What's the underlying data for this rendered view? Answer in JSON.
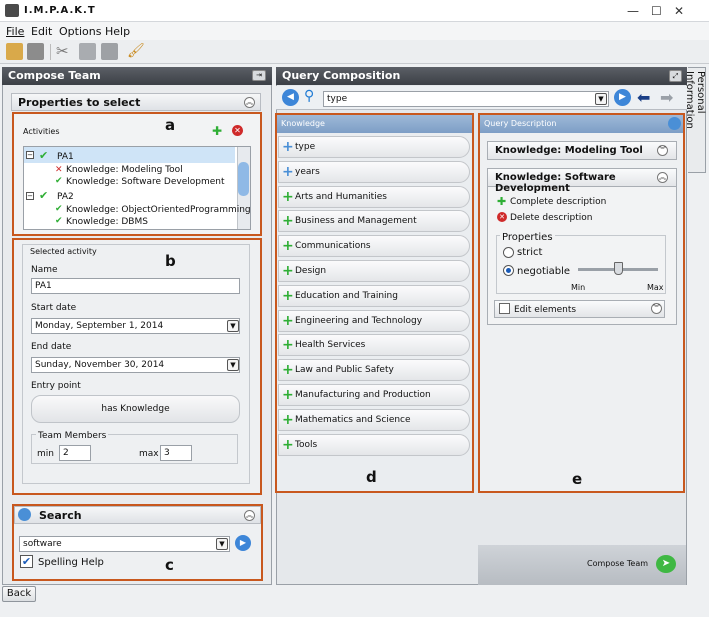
{
  "app": {
    "title": "I.M.P.A.K.T"
  },
  "window": {
    "minimize": "—",
    "maximize": "☐",
    "close": "✕"
  },
  "menu": [
    "File",
    "Edit",
    "Options",
    "Help"
  ],
  "left": {
    "panel_title": "Compose Team",
    "properties_title": "Properties to select",
    "activities_label": "Activities",
    "tree": [
      {
        "label": "PA1",
        "selected": true,
        "children": [
          "Knowledge: Modeling Tool",
          "Knowledge: Software Development"
        ]
      },
      {
        "label": "PA2",
        "selected": false,
        "children": [
          "Knowledge: ObjectOrientedProgramming",
          "Knowledge: DBMS"
        ]
      }
    ],
    "selected_activity": "Selected activity",
    "name_label": "Name",
    "name_value": "PA1",
    "start_label": "Start date",
    "start_value": "Monday, September 1, 2014",
    "end_label": "End date",
    "end_value": "Sunday, November 30, 2014",
    "entry_label": "Entry point",
    "entry_value": "has Knowledge",
    "team_label": "Team Members",
    "min_label": "min",
    "min_value": "2",
    "max_label": "max",
    "max_value": "3",
    "search_title": "Search",
    "search_value": "software",
    "spelling": "Spelling Help"
  },
  "query": {
    "panel_title": "Query Composition",
    "input": "type",
    "knowledge_title": "Knowledge",
    "knowledge": [
      {
        "label": "type",
        "color": "#4a8fd6"
      },
      {
        "label": "years",
        "color": "#4a8fd6"
      },
      {
        "label": "Arts and Humanities",
        "color": "#2fae35"
      },
      {
        "label": "Business and Management",
        "color": "#2fae35"
      },
      {
        "label": "Communications",
        "color": "#2fae35"
      },
      {
        "label": "Design",
        "color": "#2fae35"
      },
      {
        "label": "Education and Training",
        "color": "#2fae35"
      },
      {
        "label": "Engineering and Technology",
        "color": "#2fae35"
      },
      {
        "label": "Health Services",
        "color": "#2fae35"
      },
      {
        "label": "Law and Public Safety",
        "color": "#2fae35"
      },
      {
        "label": "Manufacturing and Production",
        "color": "#2fae35"
      },
      {
        "label": "Mathematics and Science",
        "color": "#2fae35"
      },
      {
        "label": "Tools",
        "color": "#2fae35"
      }
    ],
    "description_title": "Query Description",
    "desc1": "Knowledge: Modeling Tool",
    "desc2": "Knowledge: Software Development",
    "complete": "Complete description",
    "delete": "Delete description",
    "properties": "Properties",
    "strict": "strict",
    "negotiable": "negotiable",
    "min": "Min",
    "max": "Max",
    "slider_fraction": 0.5,
    "edit": "Edit elements",
    "compose": "Compose Team"
  },
  "side_tab": "Personal Information",
  "back": "Back",
  "labels": {
    "a": "a",
    "b": "b",
    "c": "c",
    "d": "d",
    "e": "e"
  }
}
